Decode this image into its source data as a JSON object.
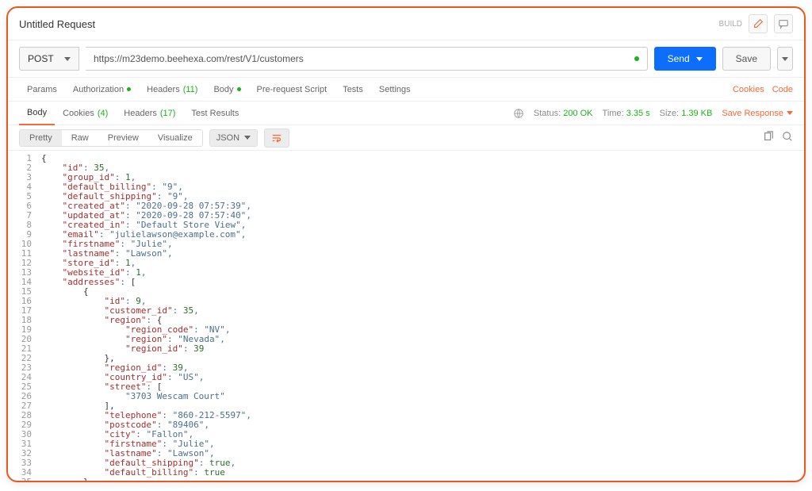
{
  "header": {
    "title": "Untitled Request",
    "build": "BUILD"
  },
  "request": {
    "method": "POST",
    "url": "https://m23demo.beehexa.com/rest/V1/customers",
    "send": "Send",
    "save": "Save"
  },
  "req_tabs": {
    "params": "Params",
    "auth": "Authorization",
    "headers": "Headers",
    "headers_count": "(11)",
    "body": "Body",
    "prereq": "Pre-request Script",
    "tests": "Tests",
    "settings": "Settings",
    "cookies": "Cookies",
    "code": "Code"
  },
  "res_tabs": {
    "body": "Body",
    "cookies": "Cookies",
    "cookies_count": "(4)",
    "headers": "Headers",
    "headers_count": "(17)",
    "test_results": "Test Results"
  },
  "status": {
    "label": "Status:",
    "value": "200 OK",
    "time_label": "Time:",
    "time_value": "3.35 s",
    "size_label": "Size:",
    "size_value": "1.39 KB",
    "save_response": "Save Response"
  },
  "toolbar": {
    "pretty": "Pretty",
    "raw": "Raw",
    "preview": "Preview",
    "visualize": "Visualize",
    "format": "JSON"
  },
  "response_json": {
    "id": 35,
    "group_id": 1,
    "default_billing": "9",
    "default_shipping": "9",
    "created_at": "2020-09-28 07:57:39",
    "updated_at": "2020-09-28 07:57:40",
    "created_in": "Default Store View",
    "email": "julielawson@example.com",
    "firstname": "Julie",
    "lastname": "Lawson",
    "store_id": 1,
    "website_id": 1,
    "addresses": [
      {
        "id": 9,
        "customer_id": 35,
        "region": {
          "region_code": "NV",
          "region": "Nevada",
          "region_id": 39
        },
        "region_id": 39,
        "country_id": "US",
        "street": [
          "3703 Wescam Court"
        ],
        "telephone": "860-212-5597",
        "postcode": "89406",
        "city": "Fallon",
        "firstname": "Julie",
        "lastname": "Lawson",
        "default_shipping": true,
        "default_billing": true
      }
    ]
  },
  "code_lines": [
    [
      0,
      [
        "brace",
        "{"
      ]
    ],
    [
      1,
      [
        "key",
        "\"id\""
      ],
      [
        "punc",
        ": "
      ],
      [
        "num",
        "35"
      ],
      [
        "punc",
        ","
      ]
    ],
    [
      1,
      [
        "key",
        "\"group_id\""
      ],
      [
        "punc",
        ": "
      ],
      [
        "num",
        "1"
      ],
      [
        "punc",
        ","
      ]
    ],
    [
      1,
      [
        "key",
        "\"default_billing\""
      ],
      [
        "punc",
        ": "
      ],
      [
        "str",
        "\"9\""
      ],
      [
        "punc",
        ","
      ]
    ],
    [
      1,
      [
        "key",
        "\"default_shipping\""
      ],
      [
        "punc",
        ": "
      ],
      [
        "str",
        "\"9\""
      ],
      [
        "punc",
        ","
      ]
    ],
    [
      1,
      [
        "key",
        "\"created_at\""
      ],
      [
        "punc",
        ": "
      ],
      [
        "str",
        "\"2020-09-28 07:57:39\""
      ],
      [
        "punc",
        ","
      ]
    ],
    [
      1,
      [
        "key",
        "\"updated_at\""
      ],
      [
        "punc",
        ": "
      ],
      [
        "str",
        "\"2020-09-28 07:57:40\""
      ],
      [
        "punc",
        ","
      ]
    ],
    [
      1,
      [
        "key",
        "\"created_in\""
      ],
      [
        "punc",
        ": "
      ],
      [
        "str",
        "\"Default Store View\""
      ],
      [
        "punc",
        ","
      ]
    ],
    [
      1,
      [
        "key",
        "\"email\""
      ],
      [
        "punc",
        ": "
      ],
      [
        "str",
        "\"julielawson@example.com\""
      ],
      [
        "punc",
        ","
      ]
    ],
    [
      1,
      [
        "key",
        "\"firstname\""
      ],
      [
        "punc",
        ": "
      ],
      [
        "str",
        "\"Julie\""
      ],
      [
        "punc",
        ","
      ]
    ],
    [
      1,
      [
        "key",
        "\"lastname\""
      ],
      [
        "punc",
        ": "
      ],
      [
        "str",
        "\"Lawson\""
      ],
      [
        "punc",
        ","
      ]
    ],
    [
      1,
      [
        "key",
        "\"store_id\""
      ],
      [
        "punc",
        ": "
      ],
      [
        "num",
        "1"
      ],
      [
        "punc",
        ","
      ]
    ],
    [
      1,
      [
        "key",
        "\"website_id\""
      ],
      [
        "punc",
        ": "
      ],
      [
        "num",
        "1"
      ],
      [
        "punc",
        ","
      ]
    ],
    [
      1,
      [
        "key",
        "\"addresses\""
      ],
      [
        "punc",
        ": "
      ],
      [
        "brace",
        "["
      ]
    ],
    [
      2,
      [
        "brace",
        "{"
      ]
    ],
    [
      3,
      [
        "key",
        "\"id\""
      ],
      [
        "punc",
        ": "
      ],
      [
        "num",
        "9"
      ],
      [
        "punc",
        ","
      ]
    ],
    [
      3,
      [
        "key",
        "\"customer_id\""
      ],
      [
        "punc",
        ": "
      ],
      [
        "num",
        "35"
      ],
      [
        "punc",
        ","
      ]
    ],
    [
      3,
      [
        "key",
        "\"region\""
      ],
      [
        "punc",
        ": "
      ],
      [
        "brace",
        "{"
      ]
    ],
    [
      4,
      [
        "key",
        "\"region_code\""
      ],
      [
        "punc",
        ": "
      ],
      [
        "str",
        "\"NV\""
      ],
      [
        "punc",
        ","
      ]
    ],
    [
      4,
      [
        "key",
        "\"region\""
      ],
      [
        "punc",
        ": "
      ],
      [
        "str",
        "\"Nevada\""
      ],
      [
        "punc",
        ","
      ]
    ],
    [
      4,
      [
        "key",
        "\"region_id\""
      ],
      [
        "punc",
        ": "
      ],
      [
        "num",
        "39"
      ]
    ],
    [
      3,
      [
        "brace",
        "},"
      ]
    ],
    [
      3,
      [
        "key",
        "\"region_id\""
      ],
      [
        "punc",
        ": "
      ],
      [
        "num",
        "39"
      ],
      [
        "punc",
        ","
      ]
    ],
    [
      3,
      [
        "key",
        "\"country_id\""
      ],
      [
        "punc",
        ": "
      ],
      [
        "str",
        "\"US\""
      ],
      [
        "punc",
        ","
      ]
    ],
    [
      3,
      [
        "key",
        "\"street\""
      ],
      [
        "punc",
        ": "
      ],
      [
        "brace",
        "["
      ]
    ],
    [
      4,
      [
        "str",
        "\"3703 Wescam Court\""
      ]
    ],
    [
      3,
      [
        "brace",
        "],"
      ]
    ],
    [
      3,
      [
        "key",
        "\"telephone\""
      ],
      [
        "punc",
        ": "
      ],
      [
        "str",
        "\"860-212-5597\""
      ],
      [
        "punc",
        ","
      ]
    ],
    [
      3,
      [
        "key",
        "\"postcode\""
      ],
      [
        "punc",
        ": "
      ],
      [
        "str",
        "\"89406\""
      ],
      [
        "punc",
        ","
      ]
    ],
    [
      3,
      [
        "key",
        "\"city\""
      ],
      [
        "punc",
        ": "
      ],
      [
        "str",
        "\"Fallon\""
      ],
      [
        "punc",
        ","
      ]
    ],
    [
      3,
      [
        "key",
        "\"firstname\""
      ],
      [
        "punc",
        ": "
      ],
      [
        "str",
        "\"Julie\""
      ],
      [
        "punc",
        ","
      ]
    ],
    [
      3,
      [
        "key",
        "\"lastname\""
      ],
      [
        "punc",
        ": "
      ],
      [
        "str",
        "\"Lawson\""
      ],
      [
        "punc",
        ","
      ]
    ],
    [
      3,
      [
        "key",
        "\"default_shipping\""
      ],
      [
        "punc",
        ": "
      ],
      [
        "bool",
        "true"
      ],
      [
        "punc",
        ","
      ]
    ],
    [
      3,
      [
        "key",
        "\"default_billing\""
      ],
      [
        "punc",
        ": "
      ],
      [
        "bool",
        "true"
      ]
    ],
    [
      2,
      [
        "brace",
        "}"
      ]
    ],
    [
      1,
      [
        "brace",
        "],"
      ]
    ]
  ]
}
